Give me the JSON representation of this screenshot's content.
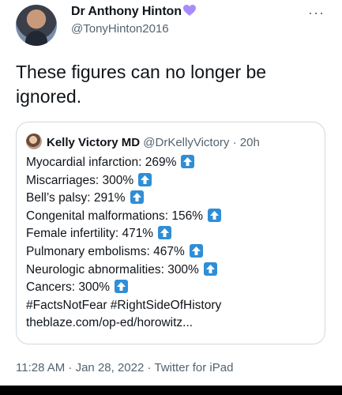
{
  "author": {
    "name": "Dr Anthony Hinton",
    "handle": "@TonyHinton2016",
    "verified_badge_icon": "purple-heart-icon",
    "badge_color": "#a78bfa"
  },
  "more_label": "···",
  "tweet": {
    "text": "These figures can no longer be ignored."
  },
  "quoted": {
    "name": "Kelly Victory MD",
    "handle": "@DrKellyVictory",
    "separator": "·",
    "time": "20h",
    "lines": [
      {
        "text": "Myocardial infarction: 269%",
        "arrow": true
      },
      {
        "text": "Miscarriages: 300%",
        "arrow": true
      },
      {
        "text": "Bell’s palsy: 291%",
        "arrow": true
      },
      {
        "text": "Congenital malformations: 156%",
        "arrow": true
      },
      {
        "text": "Female infertility: 471%",
        "arrow": true
      },
      {
        "text": "Pulmonary embolisms: 467%",
        "arrow": true
      },
      {
        "text": "Neurologic abnormalities: 300%",
        "arrow": true
      },
      {
        "text": "Cancers: 300%",
        "arrow": true
      },
      {
        "text": "#FactsNotFear #RightSideOfHistory",
        "arrow": false
      },
      {
        "text": "theblaze.com/op-ed/horowitz...",
        "arrow": false
      }
    ],
    "arrow_icon": "up-arrow-icon",
    "arrow_color": "#2f8ed6"
  },
  "footer": {
    "text": "11:28 AM · Jan 28, 2022 · Twitter for iPad"
  }
}
